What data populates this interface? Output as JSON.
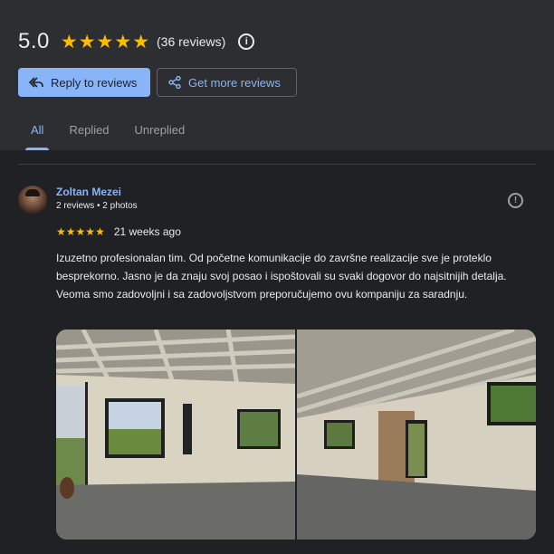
{
  "header": {
    "rating_value": "5.0",
    "rating_stars": 5,
    "review_count": "(36 reviews)",
    "info_icon": "info-icon"
  },
  "actions": {
    "reply_label": "Reply to reviews",
    "get_more_label": "Get more reviews"
  },
  "tabs": [
    {
      "label": "All",
      "active": true
    },
    {
      "label": "Replied",
      "active": false
    },
    {
      "label": "Unreplied",
      "active": false
    }
  ],
  "review": {
    "author": "Zoltan Mezei",
    "meta": "2 reviews • 2 photos",
    "stars": 5,
    "date": "21 weeks ago",
    "text": "Izuzetno profesionalan tim. Od početne komunikacije do završne realizacije sve je proteklo besprekorno. Jasno je da znaju svoj posao i ispoštovali su svaki dogovor do najsitnijih detalja. Veoma smo zadovoljni i sa zadovoljstvom preporučujemo ovu kompaniju za saradnju.",
    "photos": [
      "room-photo-1",
      "room-photo-2"
    ]
  },
  "colors": {
    "background": "#202124",
    "header_bg": "#2d2e31",
    "accent": "#8ab4f8",
    "star": "#fbbc04",
    "text": "#e8eaed",
    "muted": "#9aa0a6"
  }
}
